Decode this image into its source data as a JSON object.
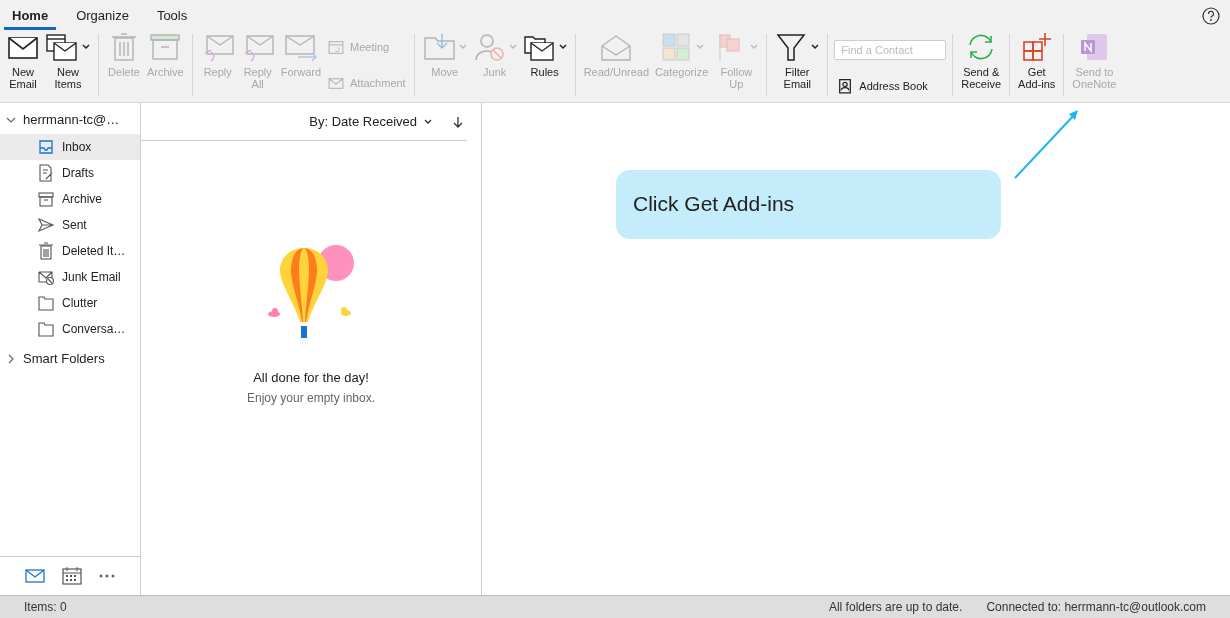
{
  "tabs": [
    {
      "label": "Home",
      "selected": true
    },
    {
      "label": "Organize",
      "selected": false
    },
    {
      "label": "Tools",
      "selected": false
    }
  ],
  "ribbon": [
    [
      [
        {
          "kind": "mail",
          "label": "New\nEmail",
          "disabled": false,
          "dropdown": false
        }
      ],
      [
        {
          "kind": "newitems",
          "label": "New\nItems",
          "disabled": false,
          "dropdown": true
        }
      ]
    ],
    [
      [
        {
          "kind": "trash",
          "label": "Delete",
          "disabled": true,
          "dropdown": false
        }
      ],
      [
        {
          "kind": "archive",
          "label": "Archive",
          "disabled": true,
          "dropdown": false
        }
      ]
    ],
    [
      [
        {
          "kind": "reply",
          "label": "Reply",
          "disabled": true,
          "dropdown": false
        }
      ],
      [
        {
          "kind": "replyall",
          "label": "Reply\nAll",
          "disabled": true,
          "dropdown": false
        }
      ],
      [
        {
          "kind": "forward",
          "label": "Forward",
          "disabled": true,
          "dropdown": false
        }
      ],
      [
        {
          "kind": "meeting",
          "label": "Meeting",
          "disabled": true,
          "dropdown": false
        },
        {
          "kind": "attachment",
          "label": "Attachment",
          "disabled": true,
          "dropdown": false
        }
      ]
    ],
    [
      [
        {
          "kind": "move",
          "label": "Move",
          "disabled": true,
          "dropdown": true
        }
      ],
      [
        {
          "kind": "junk",
          "label": "Junk",
          "disabled": true,
          "dropdown": true
        }
      ],
      [
        {
          "kind": "rules",
          "label": "Rules",
          "disabled": false,
          "dropdown": true
        }
      ]
    ],
    [
      [
        {
          "kind": "read",
          "label": "Read/Unread",
          "disabled": true,
          "dropdown": false
        }
      ],
      [
        {
          "kind": "categorize",
          "label": "Categorize",
          "disabled": true,
          "dropdown": true
        }
      ],
      [
        {
          "kind": "flag",
          "label": "Follow\nUp",
          "disabled": true,
          "dropdown": true
        }
      ]
    ],
    [
      [
        {
          "kind": "filter",
          "label": "Filter\nEmail",
          "disabled": false,
          "dropdown": true
        }
      ]
    ],
    [
      [
        {
          "kind": "field",
          "placeholder": "Find a Contact"
        },
        {
          "kind": "contacts",
          "label": "Address Book",
          "disabled": false,
          "dropdown": false
        }
      ]
    ],
    [
      [
        {
          "kind": "sync",
          "label": "Send &\nReceive",
          "disabled": false,
          "dropdown": false
        }
      ]
    ],
    [
      [
        {
          "kind": "addins",
          "label": "Get\nAdd-ins",
          "disabled": false,
          "dropdown": false
        }
      ]
    ],
    [
      [
        {
          "kind": "onenote",
          "label": "Send to\nOneNote",
          "disabled": true,
          "dropdown": false
        }
      ]
    ]
  ],
  "sidebar": {
    "account": {
      "label": "herrmann-tc@…",
      "expanded": true,
      "children": [
        {
          "kind": "inbox",
          "label": "Inbox",
          "selected": true
        },
        {
          "kind": "drafts",
          "label": "Drafts",
          "selected": false
        },
        {
          "kind": "archive",
          "label": "Archive",
          "selected": false
        },
        {
          "kind": "sent",
          "label": "Sent",
          "selected": false
        },
        {
          "kind": "trash",
          "label": "Deleted It…",
          "selected": false
        },
        {
          "kind": "junk",
          "label": "Junk Email",
          "selected": false
        },
        {
          "kind": "folder",
          "label": "Clutter",
          "selected": false
        },
        {
          "kind": "folder",
          "label": "Conversa…",
          "selected": false
        }
      ]
    },
    "smart_folders": {
      "label": "Smart Folders",
      "expanded": false
    }
  },
  "message_list": {
    "sort": "By: Date Received",
    "empty_title": "All done for the day!",
    "empty_subtitle": "Enjoy your empty inbox."
  },
  "callout": "Click Get Add-ins",
  "status_bar": {
    "items": "Items: 0",
    "sync": "All folders are up to date.",
    "connection": "Connected to: herrmann-tc@outlook.com"
  }
}
